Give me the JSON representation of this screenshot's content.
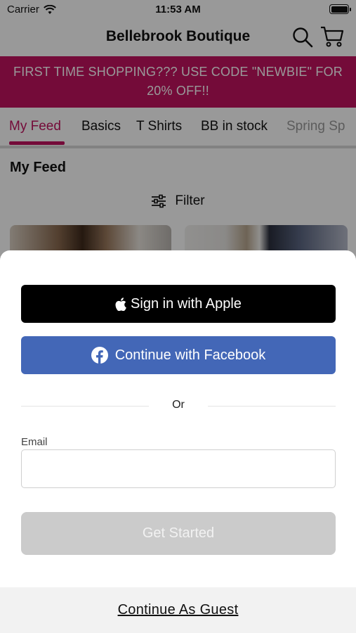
{
  "status_bar": {
    "carrier": "Carrier",
    "time": "11:53 AM",
    "battery_level": 1.0
  },
  "header": {
    "title": "Bellebrook Boutique",
    "icons": [
      "search-icon",
      "cart-icon"
    ]
  },
  "promo": {
    "text": "FIRST TIME SHOPPING??? USE CODE \"NEWBIE\" FOR 20% OFF!!"
  },
  "tabs": [
    {
      "label": "My Feed",
      "active": true
    },
    {
      "label": "Basics"
    },
    {
      "label": "T Shirts"
    },
    {
      "label": "BB in stock"
    },
    {
      "label": "Spring Sp"
    }
  ],
  "feed": {
    "heading": "My Feed",
    "filter_label": "Filter"
  },
  "sheet": {
    "apple_label": "Sign in with Apple",
    "facebook_label": "Continue with Facebook",
    "divider_text": "Or",
    "email_label": "Email",
    "email_value": "",
    "email_placeholder": "",
    "get_started_label": "Get Started",
    "guest_label": "Continue As Guest"
  },
  "colors": {
    "accent": "#c2135f",
    "facebook": "#4367b7",
    "apple": "#000000",
    "disabled_button": "#cbcbcb"
  }
}
